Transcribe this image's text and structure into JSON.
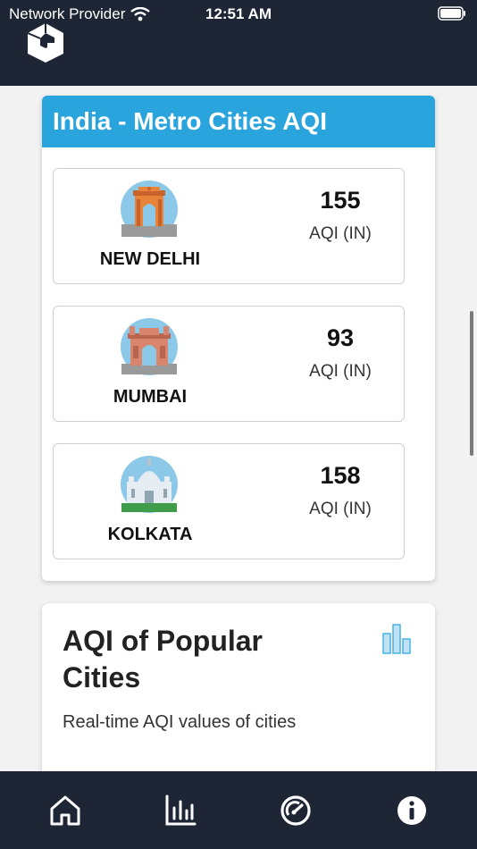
{
  "status_bar": {
    "carrier": "Network Provider",
    "time": "12:51 AM",
    "icons": [
      "wifi-icon",
      "battery-icon"
    ]
  },
  "header": {
    "logo": "app-logo-icon"
  },
  "metro": {
    "title": "India - Metro Cities AQI",
    "cities": [
      {
        "name": "NEW DELHI",
        "aqi": "155",
        "unit": "AQI (IN)",
        "icon": "india-gate-icon"
      },
      {
        "name": "MUMBAI",
        "aqi": "93",
        "unit": "AQI (IN)",
        "icon": "gateway-of-india-icon"
      },
      {
        "name": "KOLKATA",
        "aqi": "158",
        "unit": "AQI (IN)",
        "icon": "victoria-memorial-icon"
      }
    ]
  },
  "popular": {
    "title_line1": "AQI of Popular",
    "title_line2": "Cities",
    "subtitle": "Real-time AQI values of cities",
    "icon": "bar-chart-icon"
  },
  "bottom_nav": {
    "items": [
      "home-icon",
      "stats-icon",
      "gauge-icon",
      "info-icon"
    ]
  },
  "colors": {
    "header_bg": "#1e2535",
    "accent": "#2aa4dc",
    "page_bg": "#f2f2f2"
  }
}
